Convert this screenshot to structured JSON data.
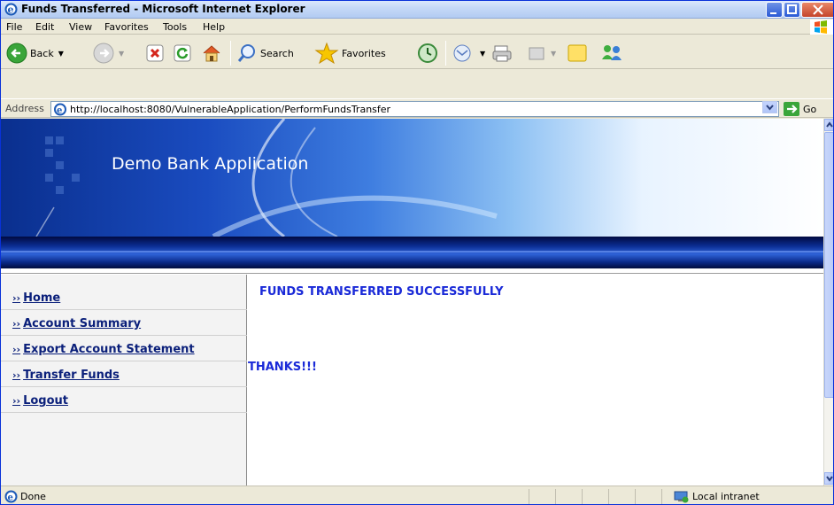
{
  "window": {
    "title": "Funds Transferred - Microsoft Internet Explorer"
  },
  "menu": {
    "items": [
      "File",
      "Edit",
      "View",
      "Favorites",
      "Tools",
      "Help"
    ]
  },
  "toolbar": {
    "back_label": "Back",
    "search_label": "Search",
    "favorites_label": "Favorites"
  },
  "address": {
    "label": "Address",
    "url": "http://localhost:8080/VulnerableApplication/PerformFundsTransfer",
    "go_label": "Go"
  },
  "page": {
    "app_title": "Demo Bank Application",
    "nav": [
      {
        "label": "Home"
      },
      {
        "label": "Account Summary"
      },
      {
        "label": "Export Account Statement"
      },
      {
        "label": "Transfer Funds"
      },
      {
        "label": "Logout"
      }
    ],
    "nav_marker": "››",
    "message": "FUNDS TRANSFERRED SUCCESSFULLY",
    "thanks": "THANKS!!!"
  },
  "status": {
    "text": "Done",
    "zone": "Local intranet"
  },
  "colors": {
    "title_bar": "#c6d9f7",
    "nav_link": "#0a1f7a",
    "message": "#1a2ad8",
    "banner_dark": "#0a2f8e"
  }
}
